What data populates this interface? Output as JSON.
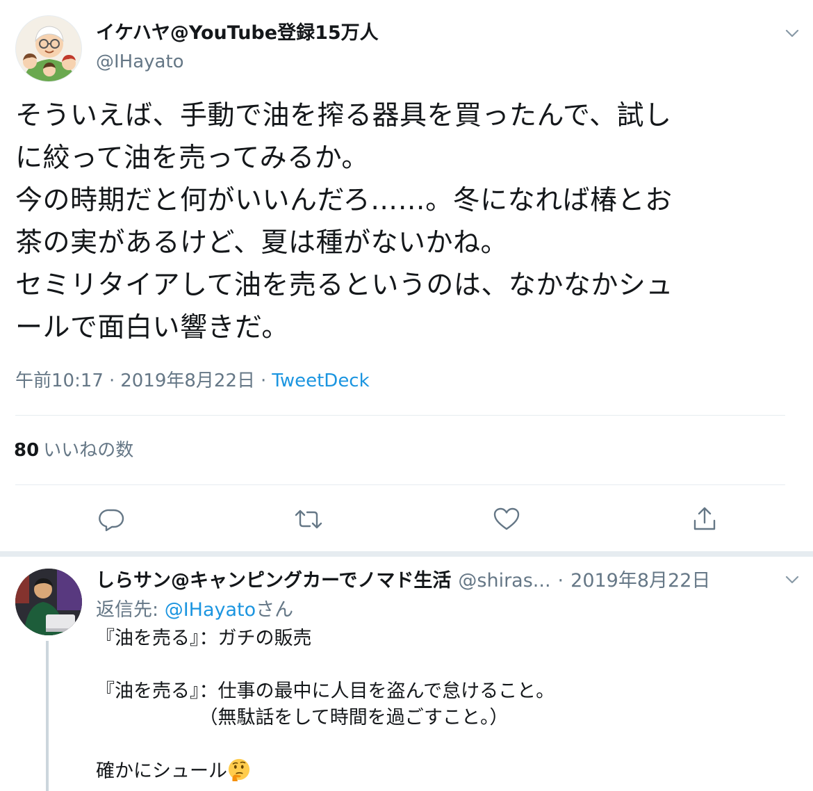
{
  "tweet": {
    "author": {
      "display_name": "イケハヤ@YouTube登録15万人",
      "handle": "@IHayato"
    },
    "text_lines": [
      "そういえば、手動で油を搾る器具を買ったんで、試し",
      "に絞って油を売ってみるか。",
      "今の時期だと何がいいんだろ……。冬になれば椿とお",
      "茶の実があるけど、夏は種がないかね。",
      "セミリタイアして油を売るというのは、なかなかシュ",
      "ールで面白い響きだ。"
    ],
    "time": "午前10:17",
    "date": "2019年8月22日",
    "separator": "·",
    "source": "TweetDeck",
    "likes_count": "80",
    "likes_label": "いいねの数"
  },
  "actions": {
    "reply_icon": "reply-icon",
    "retweet_icon": "retweet-icon",
    "like_icon": "heart-icon",
    "share_icon": "share-icon"
  },
  "reply": {
    "display_name": "しらサン@キャンピングカーでノマド生活",
    "handle": "@shiras...",
    "separator": "·",
    "date": "2019年8月22日",
    "reply_to_prefix": "返信先: ",
    "reply_to_mention": "@IHayato",
    "reply_to_suffix": "さん",
    "text_lines": [
      "『油を売る』：ガチの販売",
      "",
      "『油を売る』：仕事の最中に人目を盗んで怠けること。",
      "　　　　　　（無駄話をして時間を過ごすこと。）",
      "",
      "確かにシュール"
    ],
    "emoji": "thinking-face-emoji"
  },
  "colors": {
    "link": "#1b95e0",
    "secondary_text": "#657786",
    "primary_text": "#14171a",
    "divider": "#e6ecf0"
  }
}
